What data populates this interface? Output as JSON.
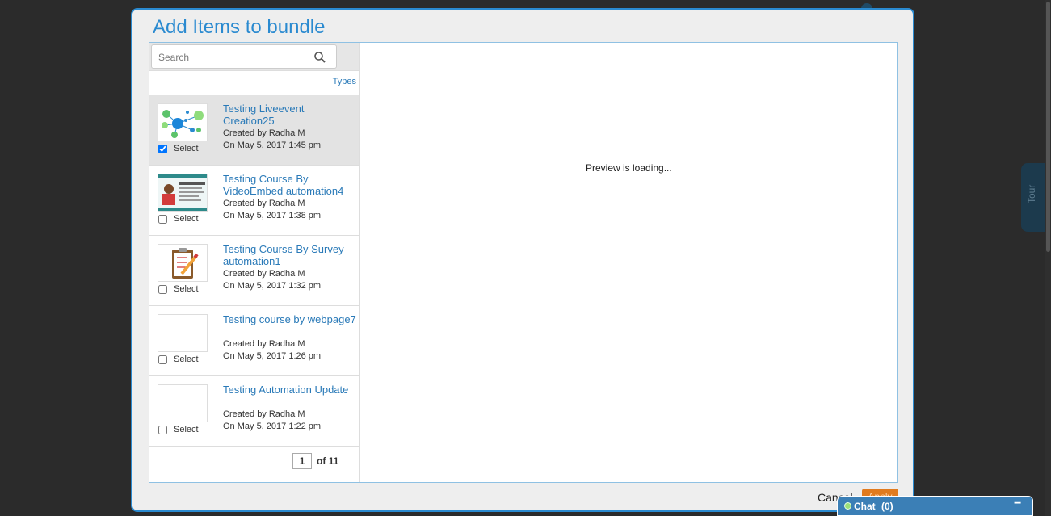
{
  "modal": {
    "title": "Add Items to bundle",
    "search_placeholder": "Search",
    "types_label": "Types",
    "preview_text": "Preview is loading...",
    "cancel_label": "Cancel",
    "apply_label": "Apply"
  },
  "items": [
    {
      "title": "Testing Liveevent Creation25",
      "creator": "Created by Radha M",
      "date": "On May 5, 2017 1:45 pm",
      "select_label": "Select",
      "checked": true,
      "thumb": "live-event-network-icon"
    },
    {
      "title": "Testing Course By VideoEmbed automation4",
      "creator": "Created by Radha M",
      "date": "On May 5, 2017 1:38 pm",
      "select_label": "Select",
      "checked": false,
      "thumb": "selenium-tutorials-thumbnail"
    },
    {
      "title": "Testing Course By Survey automation1",
      "creator": "Created by Radha M",
      "date": "On May 5, 2017 1:32 pm",
      "select_label": "Select",
      "checked": false,
      "thumb": "clipboard-pencil-icon"
    },
    {
      "title": "Testing course by webpage7",
      "creator": "Created by Radha M",
      "date": "On May 5, 2017 1:26 pm",
      "select_label": "Select",
      "checked": false,
      "thumb": "blank-thumbnail"
    },
    {
      "title": "Testing Automation Update",
      "creator": "Created by Radha M",
      "date": "On May 5, 2017 1:22 pm",
      "select_label": "Select",
      "checked": false,
      "thumb": "blank-thumbnail"
    }
  ],
  "pager": {
    "current_page": "1",
    "total_label": "of 11"
  },
  "side": {
    "tour_label": "Tour"
  },
  "chat": {
    "label": "Chat",
    "count": "(0)",
    "minimize": "−"
  },
  "colors": {
    "accent": "#2a8ad0",
    "apply": "#e07b1f",
    "chat": "#3b7fb6"
  }
}
